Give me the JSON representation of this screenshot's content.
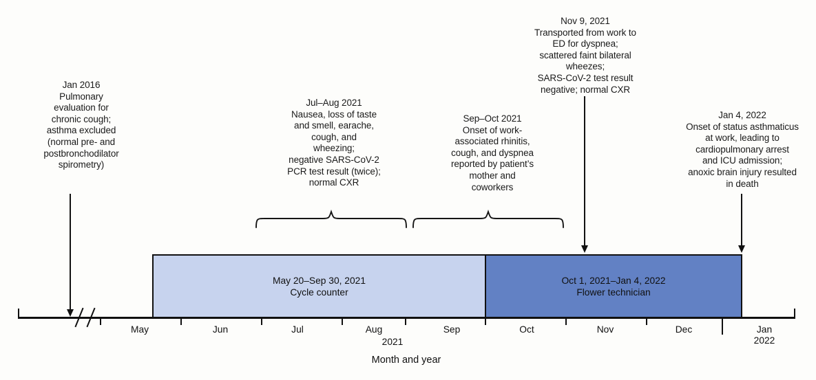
{
  "figure": {
    "axis_title": "Month and year",
    "axis_break_marker": "//",
    "year_mid_label": "2021"
  },
  "chart_data": {
    "type": "timeline",
    "title": "",
    "xlabel": "Month and year",
    "ylabel": "",
    "x_axis": {
      "tick_labels": [
        "May",
        "Jun",
        "Jul",
        "Aug",
        "Sep",
        "Oct",
        "Nov",
        "Dec",
        "Jan"
      ],
      "tick_sublabels": [
        "",
        "",
        "",
        "",
        "",
        "",
        "",
        "",
        "2022"
      ],
      "mid_axis_year": "2021",
      "has_axis_break": true,
      "break_position": "left of May, after Jan 2016 event"
    },
    "bars": [
      {
        "id": "bar-cycle-counter",
        "range_label": "May 20–Sep 30, 2021",
        "role_label": "Cycle counter",
        "start": "2021-05-20",
        "end": "2021-09-30",
        "color": "#c7d3ee",
        "border_color": "#101010"
      },
      {
        "id": "bar-flower-technician",
        "range_label": "Oct 1, 2021–Jan 4, 2022",
        "role_label": "Flower technician",
        "start": "2021-10-01",
        "end": "2022-01-04",
        "color": "#6281c4",
        "border_color": "#101010"
      }
    ],
    "events": [
      {
        "id": "event-jan-2016",
        "date_label": "Jan 2016",
        "text": "Pulmonary\nevaluation for\nchronic cough;\nasthma excluded\n(normal pre- and\npostbronchodilator\nspirometry)",
        "marker": "arrow-down-to-axis"
      },
      {
        "id": "event-jul-aug-2021",
        "date_label": "Jul–Aug 2021",
        "text": "Nausea, loss of taste\nand smell, earache,\ncough, and\nwheezing;\nnegative SARS-CoV-2\nPCR test result (twice);\nnormal CXR",
        "marker": "brace"
      },
      {
        "id": "event-sep-oct-2021",
        "date_label": "Sep–Oct 2021",
        "text": "Onset of work-\nassociated rhinitis,\ncough, and dyspnea\nreported by patient’s\nmother and\ncoworkers",
        "marker": "brace"
      },
      {
        "id": "event-nov-9-2021",
        "date_label": "Nov 9, 2021",
        "text": "Transported from work to\nED for dyspnea;\nscattered faint bilateral\nwheezes;\nSARS-CoV-2 test result\nnegative; normal CXR",
        "marker": "arrow-down-to-bar"
      },
      {
        "id": "event-jan-4-2022",
        "date_label": "Jan 4, 2022",
        "text": "Onset of status asthmaticus\nat work, leading to\ncardiopulmonary arrest\nand ICU admission;\nanoxic brain injury resulted\nin death",
        "marker": "arrow-down-to-bar"
      }
    ]
  },
  "annotations": {
    "jan2016": "Jan 2016\nPulmonary\nevaluation for\nchronic cough;\nasthma excluded\n(normal pre- and\npostbronchodilator\nspirometry)",
    "julaug2021": "Jul–Aug 2021\nNausea, loss of taste\nand smell, earache,\ncough, and\nwheezing;\nnegative SARS-CoV-2\nPCR test result (twice);\nnormal CXR",
    "sepoct2021": "Sep–Oct 2021\nOnset of work-\nassociated rhinitis,\ncough, and dyspnea\nreported by patient’s\nmother and\ncoworkers",
    "nov92021": "Nov 9, 2021\nTransported from work to\nED for dyspnea;\nscattered faint bilateral\nwheezes;\nSARS-CoV-2 test result\nnegative; normal CXR",
    "jan42022": "Jan 4, 2022\nOnset of status asthmaticus\nat work, leading to\ncardiopulmonary arrest\nand ICU admission;\nanoxic brain injury resulted\nin death"
  },
  "bars": {
    "cycle_counter": "May 20–Sep 30, 2021\nCycle counter",
    "flower_technician": "Oct 1, 2021–Jan 4, 2022\nFlower technician"
  },
  "ticks": {
    "may": "May",
    "jun": "Jun",
    "jul": "Jul",
    "aug": "Aug",
    "sep": "Sep",
    "oct": "Oct",
    "nov": "Nov",
    "dec": "Dec",
    "jan": "Jan\n2022"
  }
}
